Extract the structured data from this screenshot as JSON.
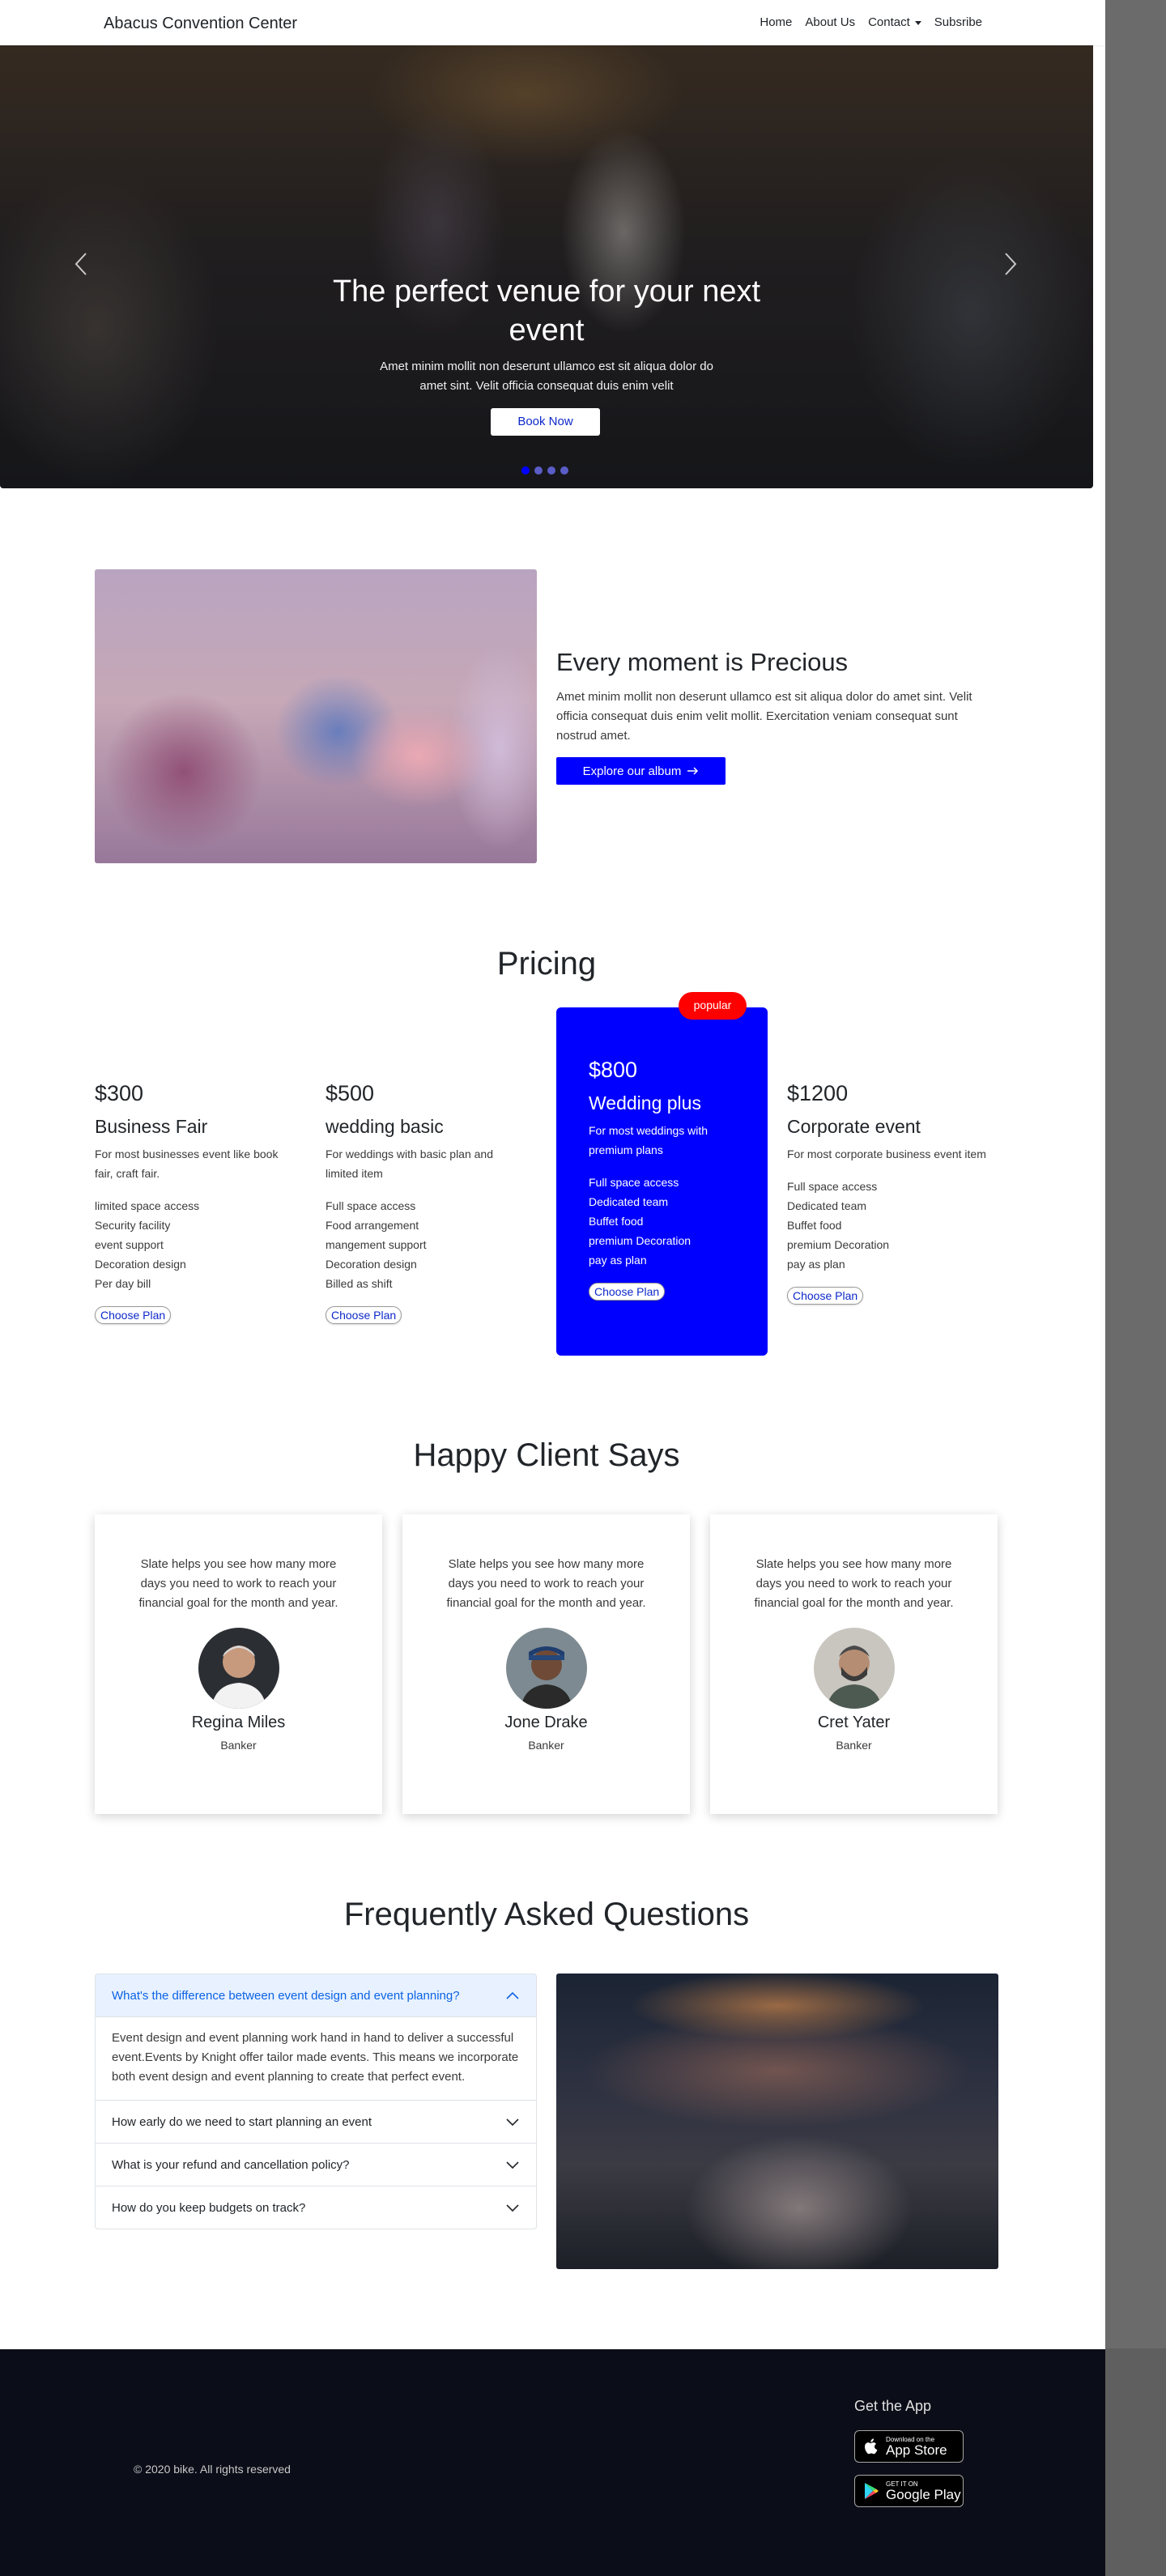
{
  "nav": {
    "brand": "Abacus Convention Center",
    "links": [
      "Home",
      "About Us",
      "Contact",
      "Subsribe"
    ]
  },
  "hero": {
    "title": "The perfect venue for your next event",
    "subtitle": "Amet minim mollit non deserunt ullamco est sit aliqua dolor do amet sint. Velit officia consequat duis enim velit",
    "button": "Book Now",
    "slides": 4,
    "active_slide": 1
  },
  "about": {
    "title": "Every moment is Precious",
    "text": "Amet minim mollit non deserunt ullamco est sit aliqua dolor do amet sint. Velit officia consequat duis enim velit mollit. Exercitation veniam consequat sunt nostrud amet.",
    "button": "Explore our album"
  },
  "pricing": {
    "title": "Pricing",
    "badge": "popular",
    "plans": [
      {
        "price": "$300",
        "name": "Business Fair",
        "desc": "For most businesses event like book fair, craft fair.",
        "features": [
          "limited space access",
          "Security facility",
          "event support",
          "Decoration design",
          "Per day bill"
        ],
        "cta": "Choose Plan"
      },
      {
        "price": "$500",
        "name": "wedding basic",
        "desc": "For weddings with basic plan and limited item",
        "features": [
          "Full space access",
          "Food arrangement",
          "mangement support",
          "Decoration design",
          "Billed as shift"
        ],
        "cta": "Choose Plan"
      },
      {
        "price": "$800",
        "name": "Wedding plus",
        "desc": "For most weddings with premium plans",
        "features": [
          "Full space access",
          "Dedicated team",
          "Buffet food",
          "premium Decoration",
          "pay as plan"
        ],
        "cta": "Choose Plan"
      },
      {
        "price": "$1200",
        "name": "Corporate event",
        "desc": "For most corporate business event item",
        "features": [
          "Full space access",
          "Dedicated team",
          "Buffet food",
          "premium Decoration",
          "pay as plan"
        ],
        "cta": "Choose Plan"
      }
    ]
  },
  "testimonials": {
    "title": "Happy Client Says",
    "items": [
      {
        "quote": "Slate helps you see how many more days you need to work to reach your financial goal for the month and year.",
        "name": "Regina Miles",
        "role": "Banker"
      },
      {
        "quote": "Slate helps you see how many more days you need to work to reach your financial goal for the month and year.",
        "name": "Jone Drake",
        "role": "Banker"
      },
      {
        "quote": "Slate helps you see how many more days you need to work to reach your financial goal for the month and year.",
        "name": "Cret Yater",
        "role": "Banker"
      }
    ]
  },
  "faq": {
    "title": "Frequently Asked Questions",
    "items": [
      {
        "q": "What's the difference between event design and event planning?",
        "a": "Event design and event planning work hand in hand to deliver a successful event.Events by Knight offer tailor made events. This means we incorporate both event design and event planning to create that perfect event.",
        "open": true
      },
      {
        "q": "How early do we need to start planning an event",
        "open": false
      },
      {
        "q": "What is your refund and cancellation policy?",
        "open": false
      },
      {
        "q": "How do you keep budgets on track?",
        "open": false
      }
    ]
  },
  "footer": {
    "copyright": "© 2020 bike. All rights reserved",
    "get_app": "Get the App",
    "app_store_small": "Download on the",
    "app_store_big": "App Store",
    "play_small": "GET IT ON",
    "play_big": "Google Play"
  },
  "colors": {
    "accent": "#0000ff",
    "badge": "#ff0000",
    "footer_bg": "#0b0d18",
    "faq_open_bg": "#e7f1ff"
  }
}
